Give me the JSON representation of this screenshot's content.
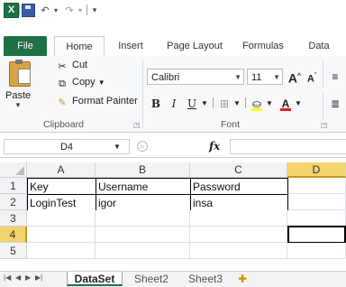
{
  "window": {
    "app_icon_label": "X"
  },
  "quick_access": {
    "undo_glyph": "↶",
    "redo_glyph": "↷",
    "more_glyph": "▾"
  },
  "tabs": [
    {
      "label": "File"
    },
    {
      "label": "Home"
    },
    {
      "label": "Insert"
    },
    {
      "label": "Page Layout"
    },
    {
      "label": "Formulas"
    },
    {
      "label": "Data"
    }
  ],
  "clipboard": {
    "paste_label": "Paste",
    "cut_label": "Cut",
    "copy_label": "Copy",
    "format_painter_label": "Format Painter",
    "group_label": "Clipboard"
  },
  "font": {
    "family_value": "Calibri",
    "size_value": "11",
    "bold_label": "B",
    "italic_label": "I",
    "underline_label": "U",
    "font_color_label": "A",
    "grow_label": "A",
    "shrink_label": "A",
    "group_label": "Font",
    "fill_color": "#ffff00",
    "font_color": "#e0201b"
  },
  "formula_bar": {
    "name_box": "D4",
    "fx_label": "fx",
    "value": ""
  },
  "grid": {
    "columns": [
      "A",
      "B",
      "C",
      "D"
    ],
    "rows": [
      "1",
      "2",
      "3",
      "4",
      "5"
    ],
    "cells": [
      [
        "Key",
        "Username",
        "Password",
        ""
      ],
      [
        "LoginTest",
        "igor",
        "insa",
        ""
      ],
      [
        "",
        "",
        "",
        ""
      ],
      [
        "",
        "",
        "",
        ""
      ],
      [
        "",
        "",
        "",
        ""
      ]
    ],
    "active_cell": "D4"
  },
  "sheets": [
    {
      "label": "DataSet"
    },
    {
      "label": "Sheet2"
    },
    {
      "label": "Sheet3"
    }
  ]
}
